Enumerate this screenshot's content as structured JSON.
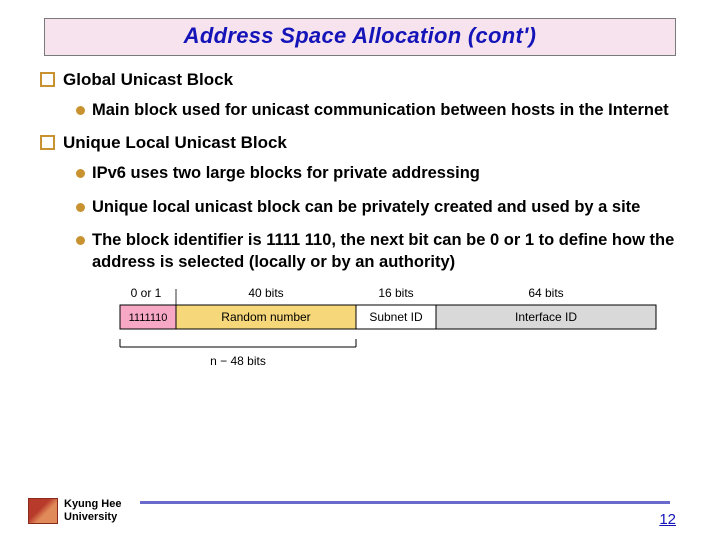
{
  "title": "Address Space Allocation (cont')",
  "sections": [
    {
      "heading": "Global Unicast Block",
      "bullets": [
        "Main block used for unicast communication between hosts in the Internet"
      ]
    },
    {
      "heading": "Unique Local Unicast Block",
      "bullets": [
        "IPv6 uses two large blocks for private addressing",
        "Unique local unicast block can be privately created and used by a site",
        "The block identifier is 1111 110, the next bit can be 0 or 1 to define how the address is selected (locally or by an authority)"
      ]
    }
  ],
  "diagram": {
    "top_labels": [
      "0 or 1",
      "40 bits",
      "16 bits",
      "64 bits"
    ],
    "fields": [
      "1111110",
      "Random number",
      "Subnet ID",
      "Interface ID"
    ],
    "bottom_label": "n − 48 bits"
  },
  "footer": {
    "university_line1": "Kyung Hee",
    "university_line2": "University",
    "page_number": "12"
  }
}
